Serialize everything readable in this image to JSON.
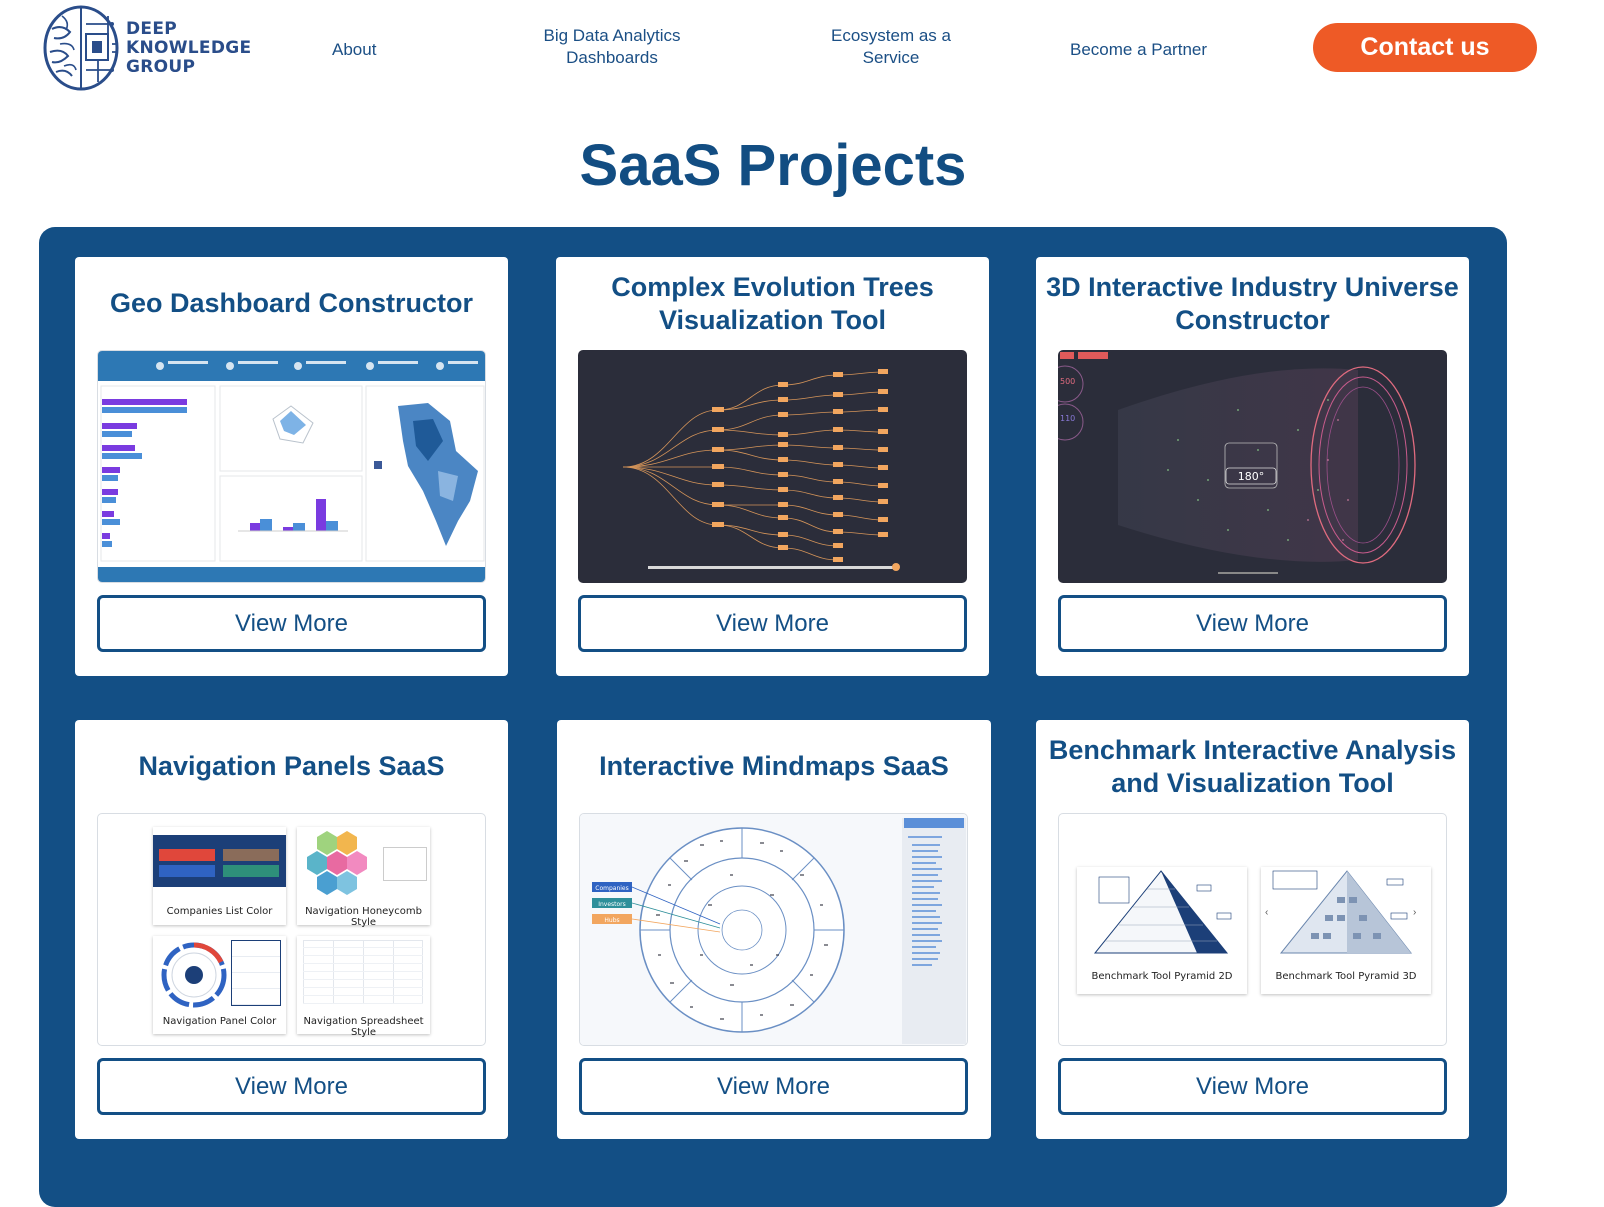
{
  "brand": {
    "name_lines": [
      "DEEP",
      "KNOWLEDGE",
      "GROUP"
    ]
  },
  "nav": {
    "about": "About",
    "big_data": "Big Data Analytics Dashboards",
    "ecosystem": "Ecosystem as a Service",
    "partner": "Become a Partner",
    "contact": "Contact us"
  },
  "page_title": "SaaS Projects",
  "colors": {
    "primary": "#134f85",
    "accent": "#ee5a26",
    "orange_lines": "#f2a65f"
  },
  "cards": [
    {
      "title": "Geo Dashboard Constructor",
      "button": "View More"
    },
    {
      "title": "Complex Evolution Trees Visualization Tool",
      "button": "View More"
    },
    {
      "title": "3D Interactive Industry Universe Constructor",
      "button": "View More",
      "screen": {
        "badge_top": "500",
        "badge_bottom": "110",
        "rotate_label": "180°"
      }
    },
    {
      "title": "Navigation Panels SaaS",
      "button": "View More",
      "thumbs": [
        "Companies List Color",
        "Navigation Honeycomb Style",
        "Navigation Panel Color",
        "Navigation Spreadsheet Style"
      ]
    },
    {
      "title": "Interactive Mindmaps SaaS",
      "button": "View More",
      "legend": [
        "Companies",
        "Investors",
        "Hubs"
      ]
    },
    {
      "title": "Benchmark Interactive Analysis and Visualization Tool",
      "button": "View More",
      "thumbs": [
        "Benchmark Tool Pyramid 2D",
        "Benchmark Tool Pyramid 3D"
      ]
    }
  ]
}
